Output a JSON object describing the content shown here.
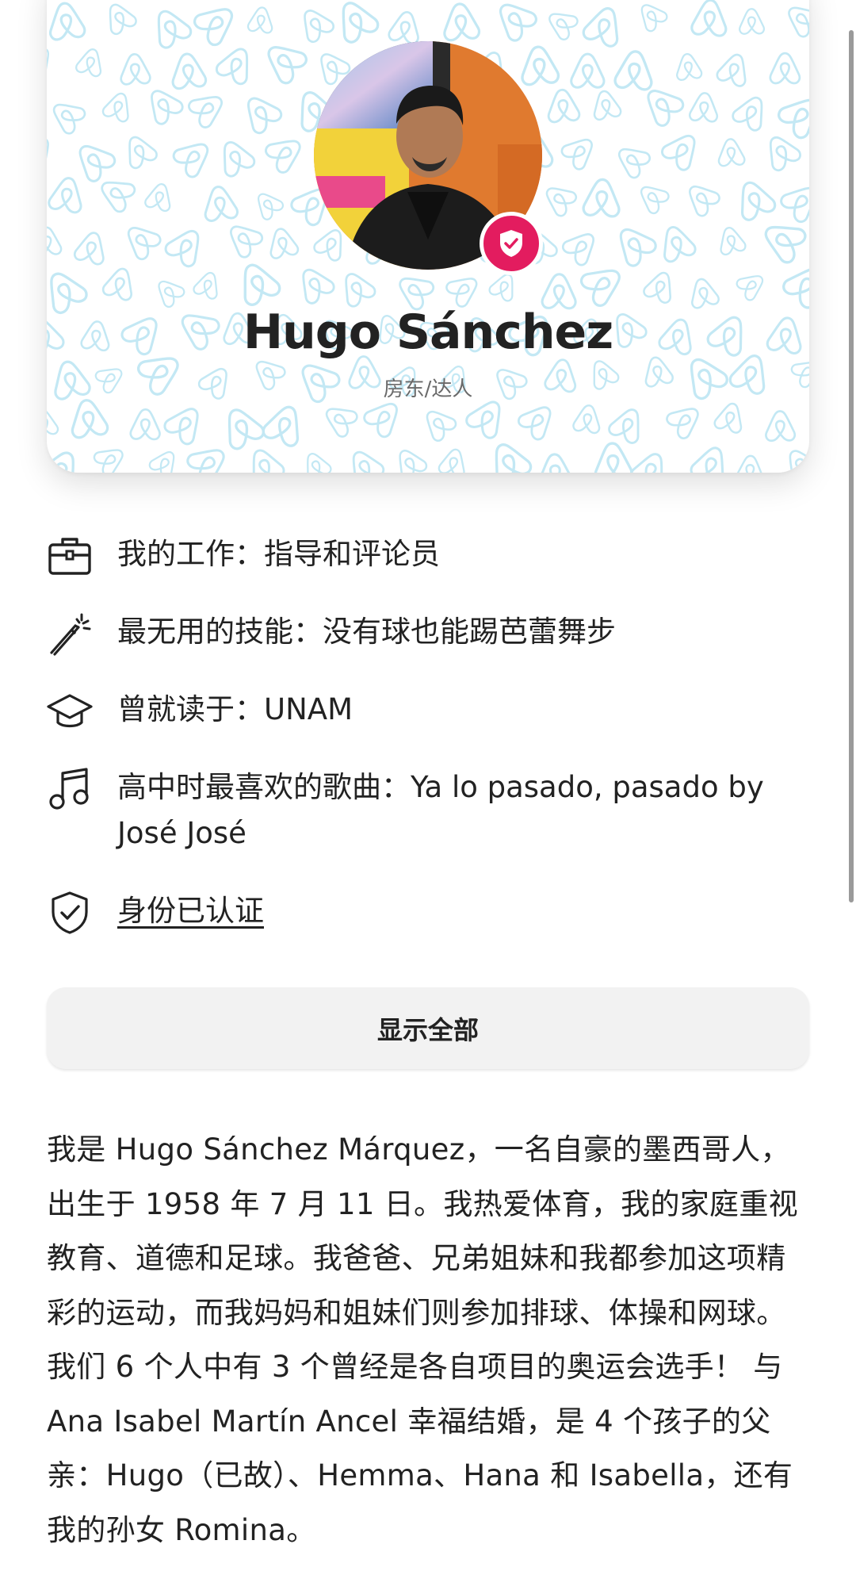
{
  "profile": {
    "name": "Hugo Sánchez",
    "role": "房东/达人",
    "avatar_icon": "host-portrait",
    "badge_icon": "verified-shield-icon"
  },
  "facts": [
    {
      "icon": "briefcase-icon",
      "label": "我的工作：",
      "value": "指导和评论员"
    },
    {
      "icon": "magic-wand-icon",
      "label": "最无用的技能：",
      "value": "没有球也能踢芭蕾舞步"
    },
    {
      "icon": "graduation-cap-icon",
      "label": "曾就读于：",
      "value": "UNAM"
    },
    {
      "icon": "music-note-icon",
      "label": "高中时最喜欢的歌曲：",
      "value": "Ya lo pasado, pasado by José José"
    },
    {
      "icon": "shield-check-icon",
      "label": "身份已认证",
      "value": ""
    }
  ],
  "show_all_label": "显示全部",
  "bio": "我是 Hugo Sánchez Márquez，一名自豪的墨西哥人，出生于 1958 年 7 月 11 日。我热爱体育，我的家庭重视教育、道德和足球。我爸爸、兄弟姐妹和我都参加这项精彩的运动，而我妈妈和姐妹们则参加排球、体操和网球。我们 6 个人中有 3 个曾经是各自项目的奥运会选手！ 与 Ana Isabel Martín Ancel 幸福结婚，是 4 个孩子的父亲：Hugo（已故）、Hemma、Hana 和 Isabella，还有我的孙女 Romina。",
  "colors": {
    "accent": "#e31c5f",
    "pattern": "#bfe7f3",
    "text": "#222222",
    "muted": "#6a6a6a",
    "button_bg": "#f2f2f2"
  }
}
